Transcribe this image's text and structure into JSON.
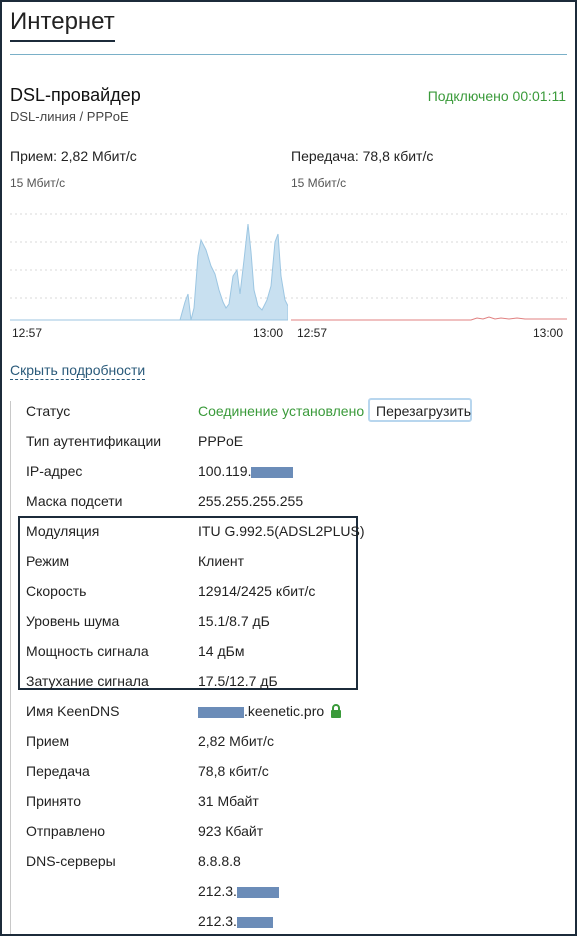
{
  "page": {
    "title": "Интернет"
  },
  "connection": {
    "name": "DSL-провайдер",
    "subtitle": "DSL-линия / PPPoE",
    "status": "Подключено 00:01:11"
  },
  "traffic": {
    "rx": {
      "label": "Прием: 2,82 Мбит/с",
      "scale": "15 Мбит/с",
      "t_start": "12:57",
      "t_end": "13:00"
    },
    "tx": {
      "label": "Передача: 78,8 кбит/с",
      "scale": "15 Мбит/с",
      "t_start": "12:57",
      "t_end": "13:00"
    }
  },
  "details_toggle": "Скрыть подробности",
  "details": {
    "status_label": "Статус",
    "status_value": "Соединение установлено",
    "reboot_label": "Перезагрузить",
    "auth_label": "Тип аутентификации",
    "auth_value": "PPPoE",
    "ip_label": "IP-адрес",
    "ip_value": "100.119.",
    "mask_label": "Маска подсети",
    "mask_value": "255.255.255.255",
    "modulation_label": "Модуляция",
    "modulation_value": "ITU G.992.5(ADSL2PLUS)",
    "mode_label": "Режим",
    "mode_value": "Клиент",
    "speed_label": "Скорость",
    "speed_value": "12914/2425 кбит/с",
    "noise_label": "Уровень шума",
    "noise_value": "15.1/8.7 дБ",
    "power_label": "Мощность сигнала",
    "power_value": "14 дБм",
    "atten_label": "Затухание сигнала",
    "atten_value": "17.5/12.7 дБ",
    "keendns_label": "Имя KeenDNS",
    "keendns_value": ".keenetic.pro",
    "rx_label": "Прием",
    "rx_value": "2,82 Мбит/с",
    "tx_label": "Передача",
    "tx_value": "78,8 кбит/с",
    "received_label": "Принято",
    "received_value": "31 Мбайт",
    "sent_label": "Отправлено",
    "sent_value": "923 Кбайт",
    "dns_label": "DNS-серверы",
    "dns_servers": [
      "8.8.8.8",
      "212.3.",
      "212.3."
    ]
  },
  "colors": {
    "accent_green": "#3a9a3a",
    "rx_fill": "#c8e0f0",
    "tx_line": "#e08080",
    "frame": "#1c2b3a",
    "redaction": "#6b8cb8"
  }
}
